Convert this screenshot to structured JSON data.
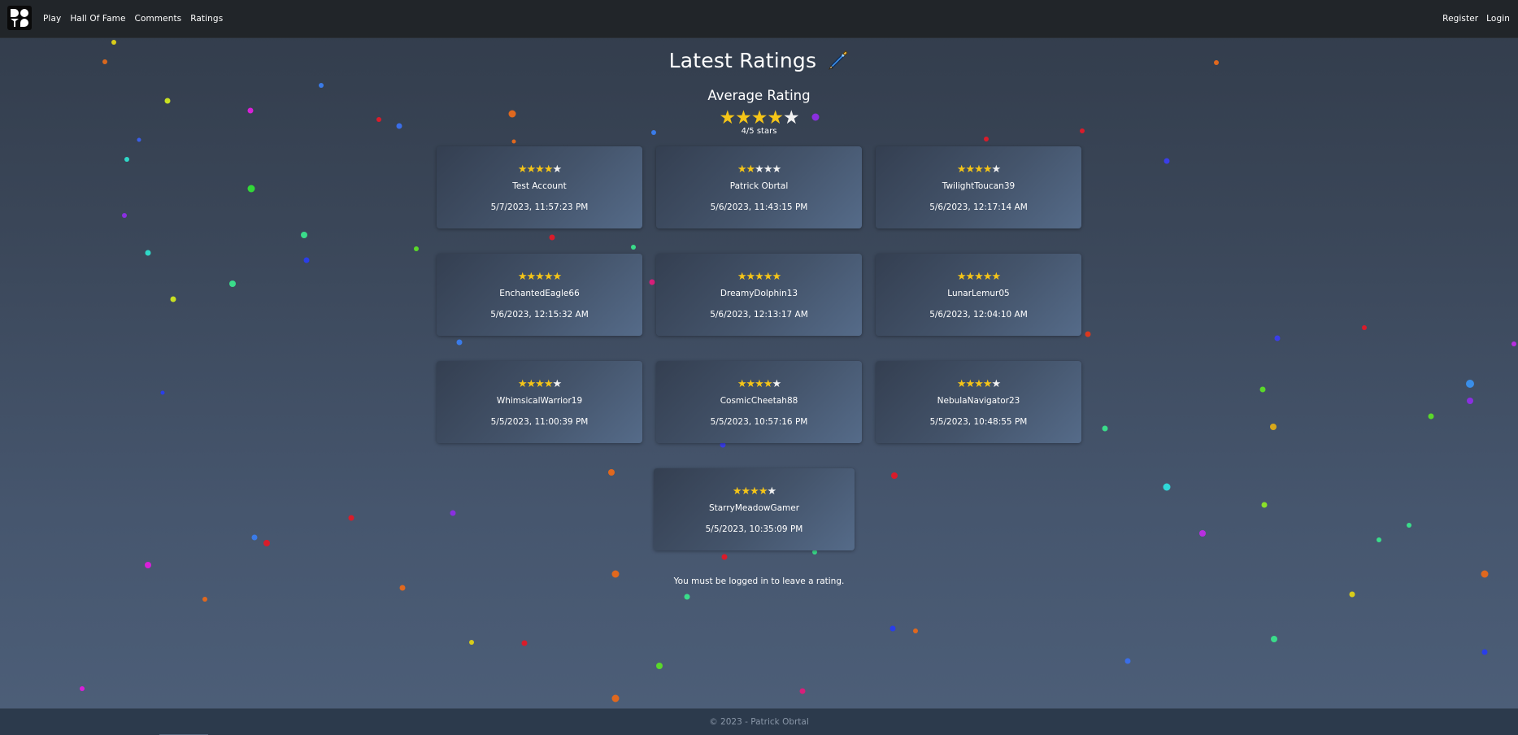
{
  "navbar": {
    "logo_name": "dots-logo",
    "links": [
      "Play",
      "Hall Of Fame",
      "Comments",
      "Ratings"
    ],
    "register_label": "Register",
    "login_label": "Login"
  },
  "page": {
    "title": "Latest Ratings",
    "title_icon": "pen-icon",
    "average_heading": "Average Rating",
    "average_value": 4,
    "average_max": 5,
    "average_caption": "4/5 stars",
    "login_notice": "You must be logged in to leave a rating."
  },
  "ratings": [
    {
      "stars": 4,
      "user": "Test Account",
      "date": "5/7/2023, 11:57:23 PM"
    },
    {
      "stars": 2,
      "user": "Patrick Obrtal",
      "date": "5/6/2023, 11:43:15 PM"
    },
    {
      "stars": 4,
      "user": "TwilightToucan39",
      "date": "5/6/2023, 12:17:14 AM"
    },
    {
      "stars": 5,
      "user": "EnchantedEagle66",
      "date": "5/6/2023, 12:15:32 AM"
    },
    {
      "stars": 5,
      "user": "DreamyDolphin13",
      "date": "5/6/2023, 12:13:17 AM"
    },
    {
      "stars": 5,
      "user": "LunarLemur05",
      "date": "5/6/2023, 12:04:10 AM"
    },
    {
      "stars": 4,
      "user": "WhimsicalWarrior19",
      "date": "5/5/2023, 11:00:39 PM"
    },
    {
      "stars": 4,
      "user": "CosmicCheetah88",
      "date": "5/5/2023, 10:57:16 PM"
    },
    {
      "stars": 4,
      "user": "NebulaNavigator23",
      "date": "5/5/2023, 10:48:55 PM"
    },
    {
      "stars": 4,
      "user": "StarryMeadowGamer",
      "date": "5/5/2023, 10:35:09 PM"
    }
  ],
  "footer": {
    "text": "© 2023 - Patrick Obrtal"
  },
  "colors": {
    "navbar_bg": "#212529",
    "star_filled": "#f5c518",
    "star_empty": "#f1f1f1",
    "footer_text": "#8a97a8"
  }
}
